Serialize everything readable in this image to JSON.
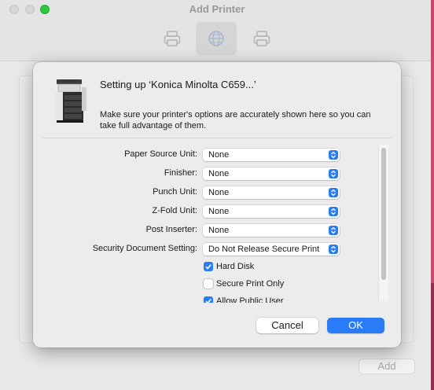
{
  "window": {
    "title": "Add Printer",
    "toolbar": [
      {
        "name": "Default",
        "icon": "printer-icon",
        "active": false
      },
      {
        "name": "IP",
        "icon": "globe-icon",
        "active": true
      },
      {
        "name": "Windows",
        "icon": "printer-icon",
        "active": false
      }
    ],
    "add_label": "Add"
  },
  "sheet": {
    "title": "Setting up ‘Konica Minolta C659...’",
    "description": "Make sure your printer's options are accurately shown here so you can take full advantage of them.",
    "options": [
      {
        "label": "Paper Source Unit:",
        "value": "None"
      },
      {
        "label": "Finisher:",
        "value": "None"
      },
      {
        "label": "Punch Unit:",
        "value": "None"
      },
      {
        "label": "Z-Fold Unit:",
        "value": "None"
      },
      {
        "label": "Post Inserter:",
        "value": "None"
      },
      {
        "label": "Security Document Setting:",
        "value": "Do Not Release Secure Print"
      }
    ],
    "checkboxes": [
      {
        "label": "Hard Disk",
        "checked": true
      },
      {
        "label": "Secure Print Only",
        "checked": false
      },
      {
        "label": "Allow Public User",
        "checked": true
      }
    ],
    "cancel_label": "Cancel",
    "ok_label": "OK"
  },
  "colors": {
    "accent": "#2a7cf6",
    "maximize": "#2ac940"
  }
}
